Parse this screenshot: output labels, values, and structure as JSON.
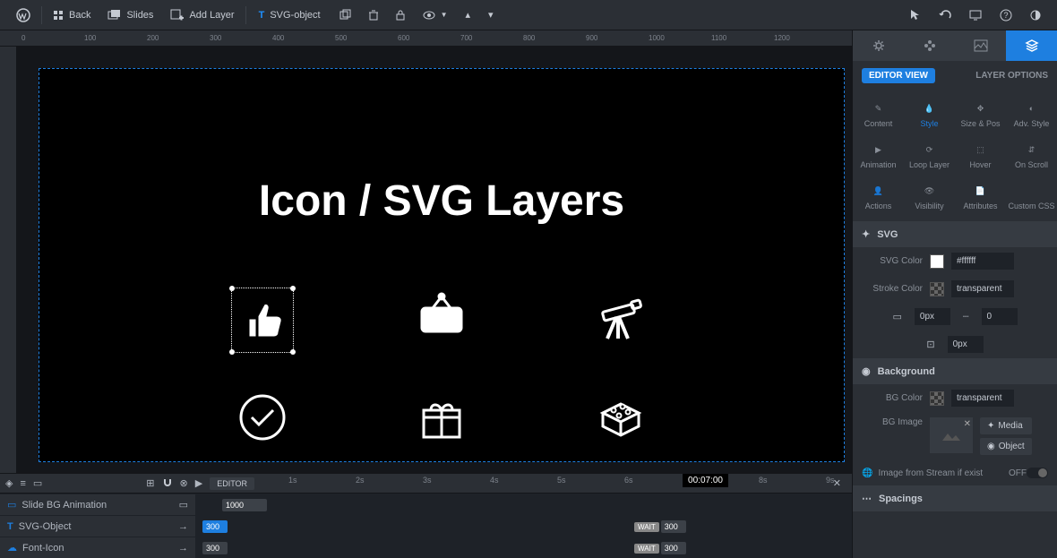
{
  "topbar": {
    "back": "Back",
    "slides": "Slides",
    "add_layer": "Add Layer",
    "tab_label": "SVG-object"
  },
  "canvas": {
    "title": "Icon / SVG Layers",
    "ruler_marks": [
      "0",
      "100",
      "200",
      "300",
      "400",
      "500",
      "600",
      "700",
      "800",
      "900",
      "1000",
      "1100",
      "1200"
    ]
  },
  "timeline": {
    "editor_badge": "EDITOR",
    "ruler": [
      "1s",
      "2s",
      "3s",
      "4s",
      "5s",
      "6s",
      "7s",
      "8s",
      "9s"
    ],
    "time": "00:07:00",
    "rows": [
      {
        "label": "Slide BG Animation",
        "bar": "1000",
        "type": "grey"
      },
      {
        "label": "SVG-Object",
        "bar": "300",
        "type": "blue",
        "wait": "WAIT",
        "wait_val": "300"
      },
      {
        "label": "Font-Icon",
        "bar": "300",
        "type": "grey",
        "wait": "WAIT",
        "wait_val": "300"
      }
    ]
  },
  "panel": {
    "editor_view": "EDITOR VIEW",
    "layer_options": "LAYER OPTIONS",
    "cats": [
      {
        "label": "Content",
        "icon": "pencil"
      },
      {
        "label": "Style",
        "icon": "drop",
        "active": true
      },
      {
        "label": "Size & Pos",
        "icon": "move"
      },
      {
        "label": "Adv. Style",
        "icon": "contrast"
      },
      {
        "label": "Animation",
        "icon": "play"
      },
      {
        "label": "Loop Layer",
        "icon": "loop"
      },
      {
        "label": "Hover",
        "icon": "hover"
      },
      {
        "label": "On Scroll",
        "icon": "scroll"
      },
      {
        "label": "Actions",
        "icon": "person"
      },
      {
        "label": "Visibility",
        "icon": "eye"
      },
      {
        "label": "Attributes",
        "icon": "doc"
      },
      {
        "label": "Custom CSS",
        "icon": "code"
      }
    ],
    "svg_section": "SVG",
    "svg_color_label": "SVG Color",
    "svg_color": "#ffffff",
    "stroke_color_label": "Stroke Color",
    "stroke_color": "transparent",
    "px1": "0px",
    "px2": "0",
    "px3": "0px",
    "bg_section": "Background",
    "bg_color_label": "BG Color",
    "bg_color": "transparent",
    "bg_image_label": "BG Image",
    "media": "Media",
    "object": "Object",
    "stream_label": "Image from Stream if exist",
    "stream_off": "OFF",
    "spacings": "Spacings"
  }
}
